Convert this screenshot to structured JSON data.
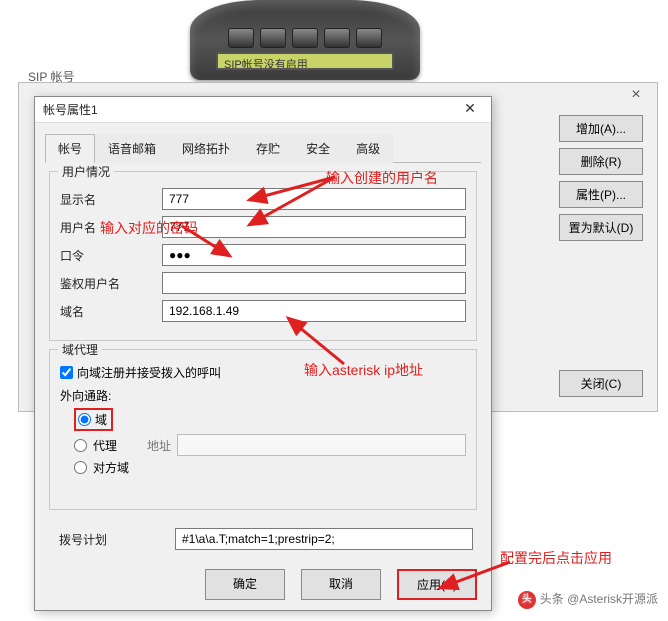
{
  "phone": {
    "lcd_text": "SIP帐号没有启用"
  },
  "outer": {
    "title": "SIP 帐号",
    "buttons": {
      "add": "增加(A)...",
      "delete": "删除(R)",
      "properties": "属性(P)...",
      "set_default": "置为默认(D)",
      "close": "关闭(C)"
    }
  },
  "dialog": {
    "title": "帐号属性1",
    "tabs": {
      "account": "帐号",
      "voicemail": "语音邮箱",
      "topology": "网络拓扑",
      "storage": "存贮",
      "security": "安全",
      "advanced": "高级"
    },
    "group_user": {
      "title": "用户情况",
      "labels": {
        "display_name": "显示名",
        "user_name": "用户名",
        "password": "口令",
        "auth_user": "鉴权用户名",
        "domain": "域名"
      },
      "values": {
        "display_name": "777",
        "user_name": "777",
        "password": "●●●",
        "auth_user": "",
        "domain": "192.168.1.49"
      }
    },
    "group_proxy": {
      "title": "域代理",
      "register_checkbox": "向域注册并接受拨入的呼叫",
      "outbound_label": "外向通路:",
      "radios": {
        "domain": "域",
        "proxy": "代理",
        "peer_domain": "对方域"
      },
      "address_label": "地址"
    },
    "dial_plan": {
      "label": "拨号计划",
      "value": "#1\\a\\a.T;match=1;prestrip=2;"
    },
    "buttons": {
      "ok": "确定",
      "cancel": "取消",
      "apply": "应用(A)"
    }
  },
  "annotations": {
    "username_hint": "输入创建的用户名",
    "password_hint": "输入对应的密码",
    "ip_hint": "输入asterisk ip地址",
    "apply_hint": "配置完后点击应用"
  },
  "watermark": {
    "text": "头条 @Asterisk开源派"
  }
}
